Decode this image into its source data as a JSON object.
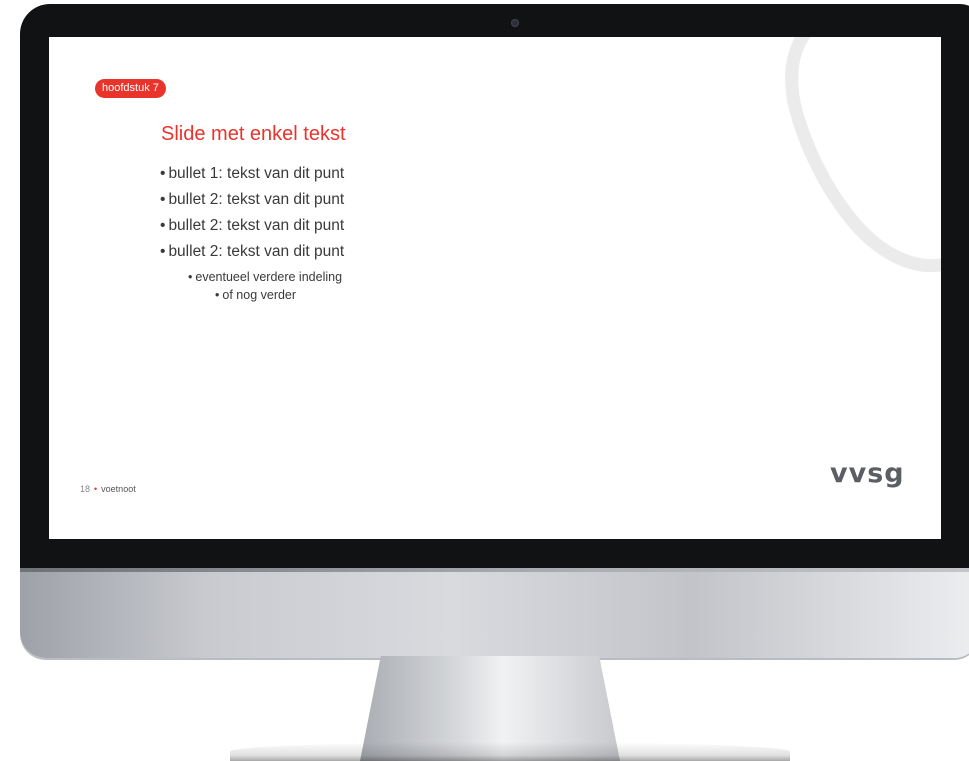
{
  "slide": {
    "chapter_badge": "hoofdstuk 7",
    "title": "Slide met enkel tekst",
    "bullets": [
      "bullet 1: tekst van dit punt",
      "bullet 2: tekst van dit punt",
      "bullet 2: tekst van dit punt",
      "bullet 2: tekst van dit punt"
    ],
    "sub_bullet": "eventueel verdere indeling",
    "sub_sub_bullet": "of nog verder",
    "bullet_symbol": "•",
    "footer": {
      "page_number": "18",
      "separator": "•",
      "footnote": "voetnoot"
    },
    "logo_text": "vvsg"
  },
  "colors": {
    "accent": "#e8342b",
    "logo": "#5b5e63",
    "text": "#3a3a3a"
  },
  "icons": {
    "camera": "webcam-icon"
  }
}
